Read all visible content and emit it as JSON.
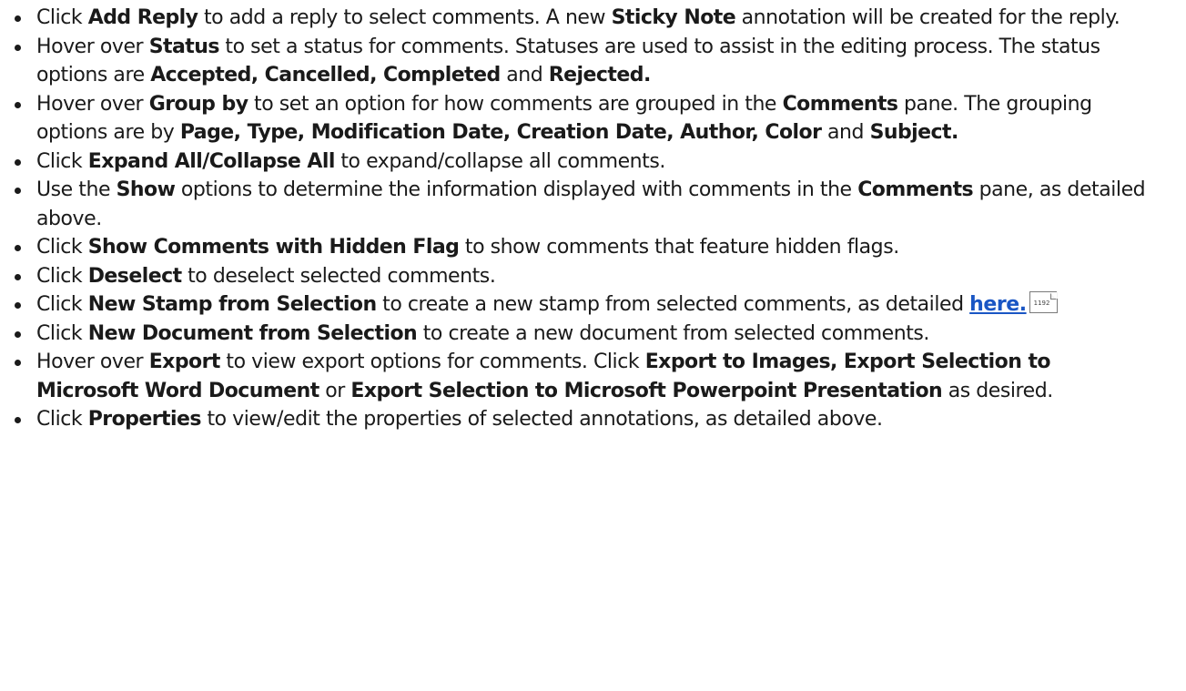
{
  "items": [
    {
      "parts": [
        {
          "t": "Click ",
          "b": false
        },
        {
          "t": "Add Reply",
          "b": true
        },
        {
          "t": " to add a reply to select comments. A new ",
          "b": false
        },
        {
          "t": "Sticky Note",
          "b": true
        },
        {
          "t": " annotation will be created for the reply.",
          "b": false
        }
      ]
    },
    {
      "parts": [
        {
          "t": "Hover over ",
          "b": false
        },
        {
          "t": "Status",
          "b": true
        },
        {
          "t": " to set a status for comments. Statuses are used to assist in the editing process. The status options are ",
          "b": false
        },
        {
          "t": "Accepted, Cancelled, Completed",
          "b": true
        },
        {
          "t": " and ",
          "b": false
        },
        {
          "t": "Rejected.",
          "b": true
        }
      ]
    },
    {
      "parts": [
        {
          "t": "Hover over ",
          "b": false
        },
        {
          "t": "Group by",
          "b": true
        },
        {
          "t": " to set an option for how comments are grouped in the ",
          "b": false
        },
        {
          "t": "Comments",
          "b": true
        },
        {
          "t": " pane. The grouping options are by ",
          "b": false
        },
        {
          "t": "Page, Type, Modification Date, Creation Date, Author, Color",
          "b": true
        },
        {
          "t": " and ",
          "b": false
        },
        {
          "t": "Subject.",
          "b": true
        }
      ]
    },
    {
      "parts": [
        {
          "t": "Click ",
          "b": false
        },
        {
          "t": "Expand All/Collapse All",
          "b": true
        },
        {
          "t": " to expand/collapse all comments.",
          "b": false
        }
      ]
    },
    {
      "parts": [
        {
          "t": "Use the ",
          "b": false
        },
        {
          "t": "Show",
          "b": true
        },
        {
          "t": " options to determine the information displayed with comments in the ",
          "b": false
        },
        {
          "t": "Comments",
          "b": true
        },
        {
          "t": " pane, as detailed above.",
          "b": false
        }
      ]
    },
    {
      "parts": [
        {
          "t": "Click ",
          "b": false
        },
        {
          "t": "Show Comments with Hidden Flag",
          "b": true
        },
        {
          "t": " to show comments that feature hidden flags.",
          "b": false
        }
      ]
    },
    {
      "parts": [
        {
          "t": "Click ",
          "b": false
        },
        {
          "t": "Deselect",
          "b": true
        },
        {
          "t": " to deselect selected comments.",
          "b": false
        }
      ]
    },
    {
      "parts": [
        {
          "t": "Click ",
          "b": false
        },
        {
          "t": "New Stamp from Selection",
          "b": true
        },
        {
          "t": " to create a new stamp from selected comments, as detailed ",
          "b": false
        },
        {
          "t": "here.",
          "link": true
        },
        {
          "pageRef": "1192"
        }
      ]
    },
    {
      "parts": [
        {
          "t": "Click ",
          "b": false
        },
        {
          "t": "New Document from Selection",
          "b": true
        },
        {
          "t": " to create a new document from selected comments.",
          "b": false
        }
      ]
    },
    {
      "parts": [
        {
          "t": "Hover over ",
          "b": false
        },
        {
          "t": "Export",
          "b": true
        },
        {
          "t": " to view export options for comments. Click ",
          "b": false
        },
        {
          "t": "Export to Images, Export Selection to Microsoft Word Document",
          "b": true
        },
        {
          "t": " or ",
          "b": false
        },
        {
          "t": "Export Selection to Microsoft Powerpoint Presentation",
          "b": true
        },
        {
          "t": " as desired.",
          "b": false
        }
      ]
    },
    {
      "parts": [
        {
          "t": "Click ",
          "b": false
        },
        {
          "t": "Properties",
          "b": true
        },
        {
          "t": " to view/edit the properties of selected annotations, as detailed above.",
          "b": false
        }
      ]
    }
  ]
}
